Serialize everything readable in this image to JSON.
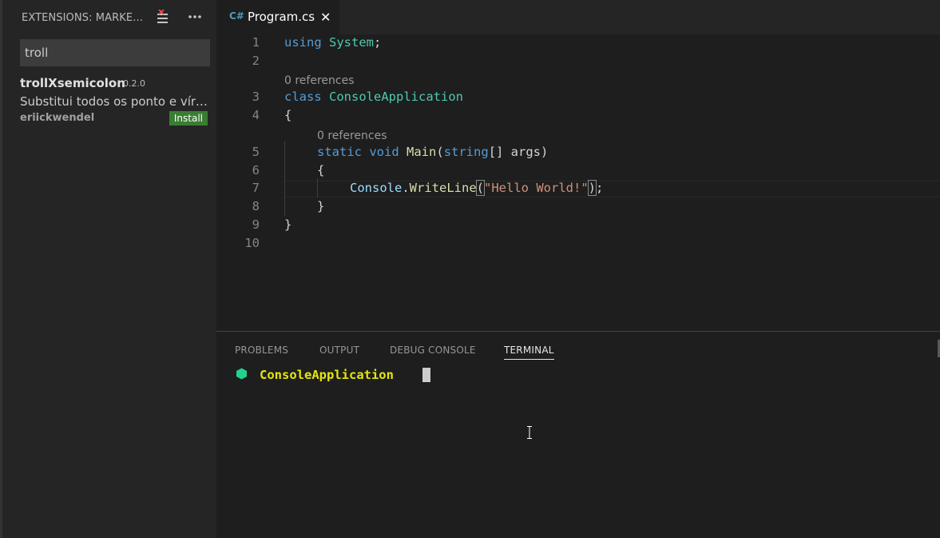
{
  "sidebar": {
    "title": "EXTENSIONS: MARKETPLACE",
    "search": {
      "value": "troll"
    },
    "extension": {
      "name": "trollXsemicolon",
      "version": "0.2.0",
      "description": "Substitui todos os ponto e vírgula por um caractere grego",
      "publisher": "eriickwendel",
      "install_label": "Install"
    }
  },
  "tabs": [
    {
      "icon": "C#",
      "label": "Program.cs"
    }
  ],
  "editor": {
    "line_numbers": [
      "1",
      "2",
      "3",
      "4",
      "5",
      "6",
      "7",
      "8",
      "9",
      "10"
    ],
    "codelens": [
      "0 references",
      "0 references"
    ],
    "lines": {
      "l1": {
        "kw": "using",
        "rest": "System",
        "semi": ";"
      },
      "l3": {
        "kw": "class",
        "name": "ConsoleApplication"
      },
      "l4": "{",
      "l5": {
        "kw1": "static",
        "kw2": "void",
        "fn": "Main",
        "open": "(",
        "type": "string",
        "rest": "[] args)"
      },
      "l6": "{",
      "l7": {
        "obj": "Console",
        "dot": ".",
        "fn": "WriteLine",
        "open": "(",
        "str": "\"Hello World!\"",
        "close": ")",
        "semi": ";"
      },
      "l8": "}",
      "l9": "}"
    }
  },
  "panel": {
    "tabs": [
      "PROBLEMS",
      "OUTPUT",
      "DEBUG CONSOLE",
      "TERMINAL"
    ],
    "active_tab": "TERMINAL",
    "terminal": {
      "prompt": "ConsoleApplication"
    }
  },
  "colors": {
    "accent_green": "#3a7d32",
    "prompt_yellow": "#e5e510",
    "prompt_icon": "#23d18b",
    "keyword": "#569cd6",
    "type": "#4ec9b0"
  }
}
